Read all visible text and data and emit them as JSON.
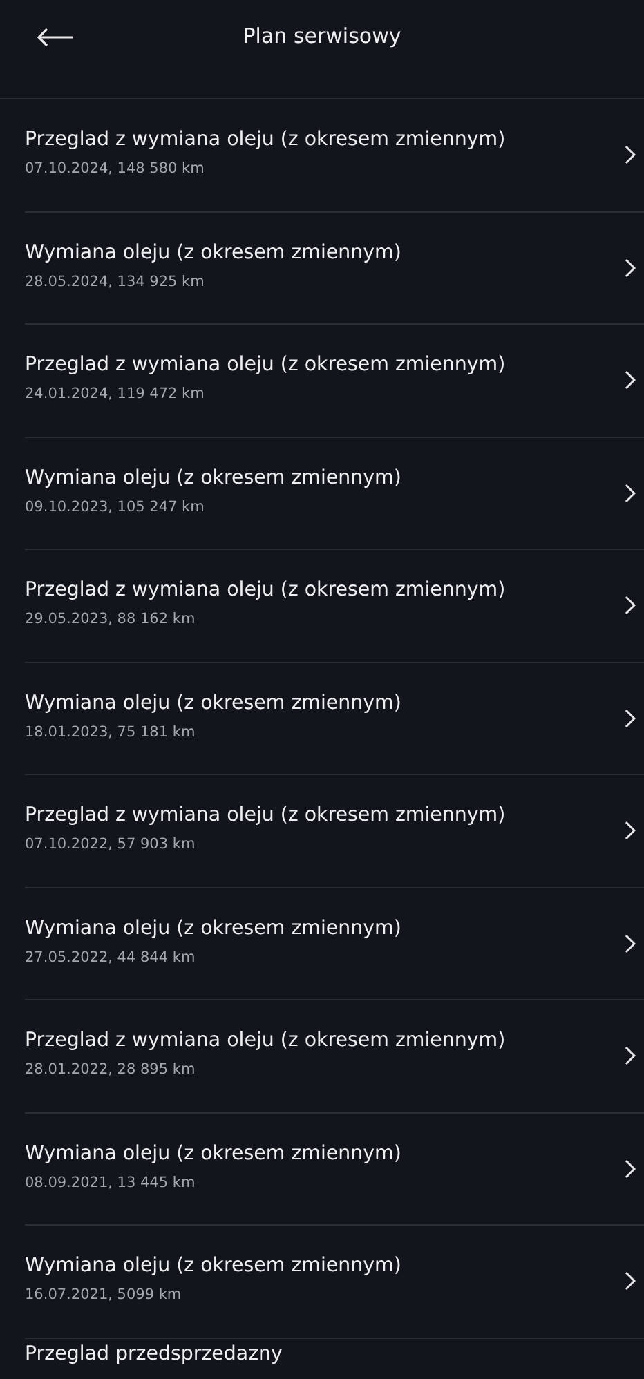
{
  "header": {
    "title": "Plan serwisowy"
  },
  "items": [
    {
      "title": "Przeglad z wymiana oleju (z okresem zmiennym)",
      "subtitle": "07.10.2024, 148 580 km"
    },
    {
      "title": "Wymiana oleju (z okresem zmiennym)",
      "subtitle": "28.05.2024, 134 925 km"
    },
    {
      "title": "Przeglad z wymiana oleju (z okresem zmiennym)",
      "subtitle": "24.01.2024, 119 472 km"
    },
    {
      "title": "Wymiana oleju (z okresem zmiennym)",
      "subtitle": "09.10.2023, 105 247 km"
    },
    {
      "title": "Przeglad z wymiana oleju (z okresem zmiennym)",
      "subtitle": "29.05.2023, 88 162 km"
    },
    {
      "title": "Wymiana oleju (z okresem zmiennym)",
      "subtitle": "18.01.2023, 75 181 km"
    },
    {
      "title": "Przeglad z wymiana oleju (z okresem zmiennym)",
      "subtitle": "07.10.2022, 57 903 km"
    },
    {
      "title": "Wymiana oleju (z okresem zmiennym)",
      "subtitle": "27.05.2022, 44 844 km"
    },
    {
      "title": "Przeglad z wymiana oleju (z okresem zmiennym)",
      "subtitle": "28.01.2022, 28 895 km"
    },
    {
      "title": "Wymiana oleju (z okresem zmiennym)",
      "subtitle": "08.09.2021, 13 445 km"
    },
    {
      "title": "Wymiana oleju (z okresem zmiennym)",
      "subtitle": "16.07.2021, 5099 km"
    },
    {
      "title": "Przeglad przedsprzedazny"
    }
  ]
}
